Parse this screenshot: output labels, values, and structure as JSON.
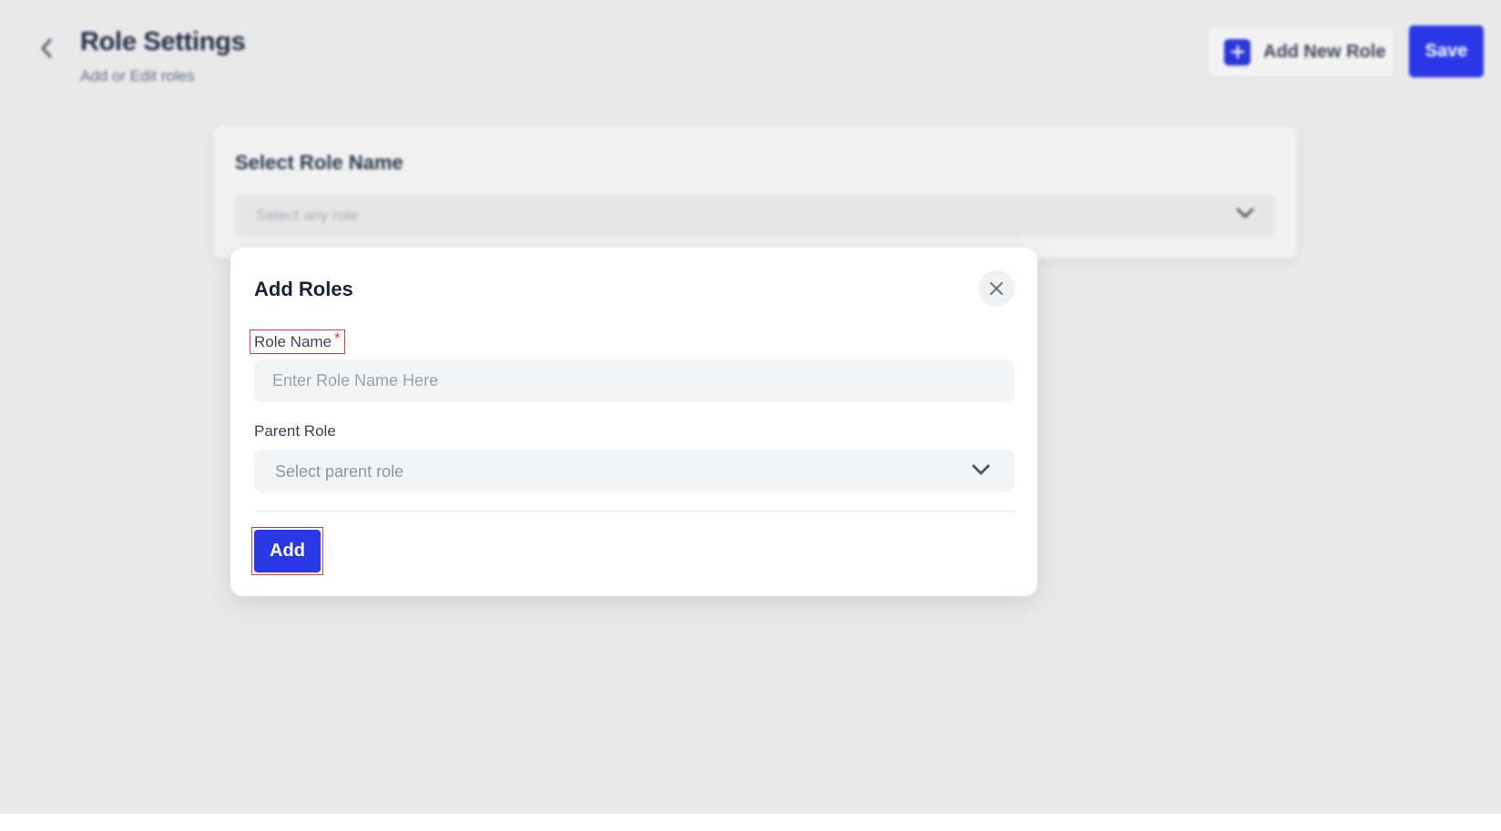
{
  "header": {
    "title": "Role Settings",
    "subtitle": "Add or Edit roles",
    "add_new_role_label": "Add New Role",
    "save_label": "Save"
  },
  "role_card": {
    "title": "Select Role Name",
    "select_placeholder": "Select any role"
  },
  "modal": {
    "title": "Add Roles",
    "role_name_label": "Role Name",
    "required_marker": "*",
    "role_name_placeholder": "Enter Role Name Here",
    "parent_role_label": "Parent Role",
    "parent_role_placeholder": "Select parent role",
    "add_label": "Add"
  },
  "colors": {
    "accent": "#2a37e6",
    "highlight": "#e53935",
    "background": "#e9e9e9"
  },
  "icons": [
    "chevron-left-icon",
    "plus-icon",
    "chevron-down-icon",
    "close-icon"
  ]
}
